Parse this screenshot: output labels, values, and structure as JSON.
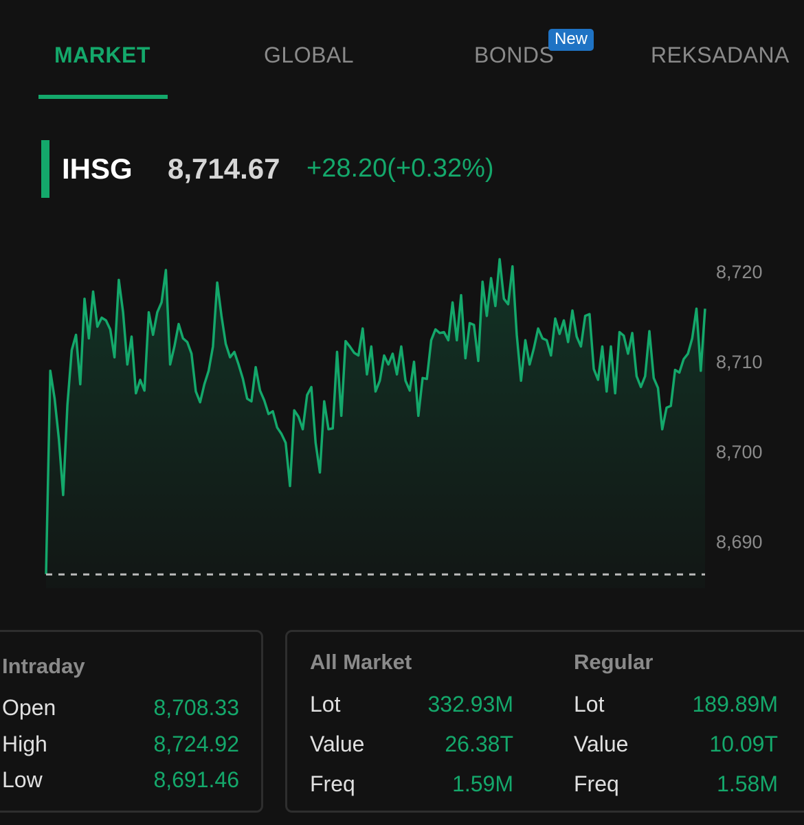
{
  "tabs": [
    {
      "label": "MARKET",
      "active": true
    },
    {
      "label": "GLOBAL",
      "active": false
    },
    {
      "label": "BONDS",
      "active": false,
      "badge": "New"
    },
    {
      "label": "REKSADANA",
      "active": false
    }
  ],
  "index": {
    "name": "IHSG",
    "price": "8,714.67",
    "change": "+28.20(+0.32%)"
  },
  "colors": {
    "accent": "#14a86b",
    "background": "#121212",
    "badge": "#1f73c4"
  },
  "chart_data": {
    "type": "area",
    "title": "IHSG intraday",
    "ylim": [
      8686.47,
      8722
    ],
    "yticks": [
      "8,720",
      "8,710",
      "8,700",
      "8,690"
    ],
    "ytick_values": [
      8720,
      8710,
      8700,
      8690
    ],
    "baseline": 8686.47,
    "values": [
      8686.5,
      8709.1,
      8706.0,
      8701.5,
      8695.3,
      8705.3,
      8711.4,
      8713.1,
      8707.6,
      8717.1,
      8712.7,
      8717.9,
      8714.0,
      8715.0,
      8714.7,
      8713.7,
      8710.6,
      8719.2,
      8715.6,
      8709.8,
      8712.9,
      8706.6,
      8708.1,
      8706.9,
      8715.6,
      8713.1,
      8715.6,
      8716.7,
      8720.3,
      8709.8,
      8711.8,
      8714.3,
      8712.7,
      8712.3,
      8711.0,
      8706.8,
      8705.6,
      8707.6,
      8709.1,
      8711.8,
      8718.9,
      8715.2,
      8712.1,
      8710.6,
      8711.2,
      8709.8,
      8708.2,
      8706.0,
      8705.7,
      8709.5,
      8706.9,
      8705.8,
      8704.3,
      8704.6,
      8702.8,
      8702.1,
      8701.1,
      8696.3,
      8704.7,
      8704.0,
      8702.6,
      8706.4,
      8707.3,
      8701.1,
      8697.8,
      8705.7,
      8702.6,
      8702.7,
      8711.2,
      8704.1,
      8712.4,
      8711.8,
      8711.1,
      8710.8,
      8713.8,
      8708.7,
      8711.8,
      8706.8,
      8708.0,
      8710.8,
      8709.8,
      8711.0,
      8708.7,
      8711.8,
      8708.0,
      8706.9,
      8710.1,
      8704.1,
      8708.3,
      8708.2,
      8712.5,
      8713.7,
      8713.3,
      8713.4,
      8712.5,
      8716.7,
      8712.5,
      8717.5,
      8710.5,
      8714.4,
      8714.2,
      8710.2,
      8719.0,
      8715.2,
      8719.4,
      8716.3,
      8721.5,
      8717.1,
      8716.5,
      8720.7,
      8713.1,
      8708.0,
      8712.5,
      8709.8,
      8711.6,
      8713.8,
      8712.7,
      8712.5,
      8710.8,
      8714.9,
      8713.2,
      8714.7,
      8712.3,
      8715.8,
      8712.9,
      8711.8,
      8715.2,
      8715.4,
      8709.3,
      8708.1,
      8711.8,
      8706.8,
      8711.8,
      8706.6,
      8713.4,
      8713.0,
      8711.0,
      8713.3,
      8708.5,
      8707.3,
      8708.5,
      8713.5,
      8708.3,
      8707.2,
      8702.6,
      8705.0,
      8705.2,
      8709.2,
      8708.9,
      8710.4,
      8711.0,
      8712.7,
      8716.0,
      8709.1,
      8716.0
    ]
  },
  "intraday": {
    "title": "Intraday",
    "rows": [
      {
        "label": "Open",
        "value": "8,708.33"
      },
      {
        "label": "High",
        "value": "8,724.92"
      },
      {
        "label": "Low",
        "value": "8,691.46"
      }
    ]
  },
  "all_market": {
    "title": "All Market",
    "rows": [
      {
        "label": "Lot",
        "value": "332.93M"
      },
      {
        "label": "Value",
        "value": "26.38T"
      },
      {
        "label": "Freq",
        "value": "1.59M"
      }
    ]
  },
  "regular": {
    "title": "Regular",
    "rows": [
      {
        "label": "Lot",
        "value": "189.89M"
      },
      {
        "label": "Value",
        "value": "10.09T"
      },
      {
        "label": "Freq",
        "value": "1.58M"
      }
    ]
  }
}
